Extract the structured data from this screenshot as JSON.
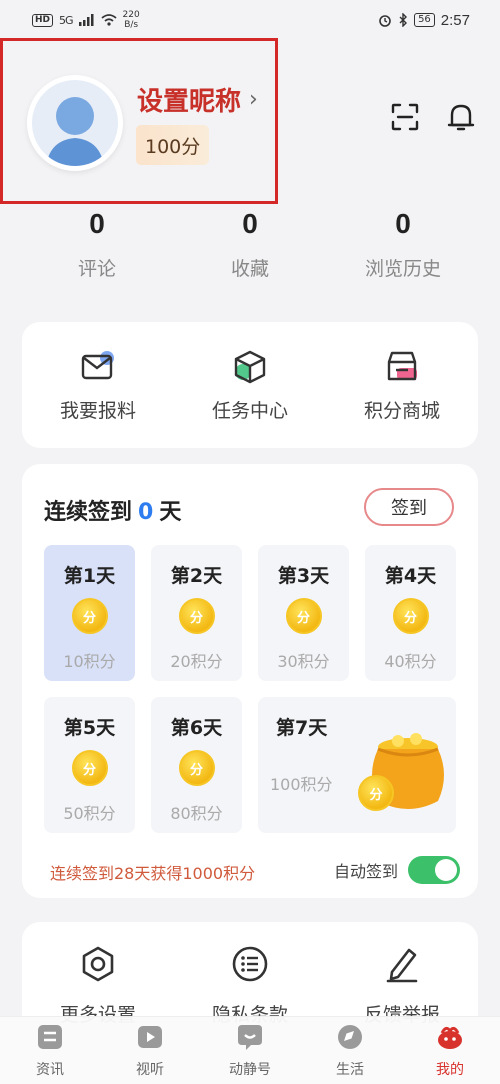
{
  "status_bar": {
    "hd": "HD",
    "network": "5G",
    "speed_value": "220",
    "speed_unit": "B/s",
    "battery": "56",
    "time": "2:57"
  },
  "profile": {
    "nickname": "设置昵称",
    "points": "100分"
  },
  "stats": [
    {
      "value": "0",
      "label": "评论"
    },
    {
      "value": "0",
      "label": "收藏"
    },
    {
      "value": "0",
      "label": "浏览历史"
    }
  ],
  "quick_actions": [
    {
      "label": "我要报料",
      "icon": "mail-icon"
    },
    {
      "label": "任务中心",
      "icon": "box-icon"
    },
    {
      "label": "积分商城",
      "icon": "shop-icon"
    }
  ],
  "signin": {
    "title_prefix": "连续签到",
    "days_count": "0",
    "title_suffix": "天",
    "button": "签到",
    "days": [
      {
        "title": "第1天",
        "points": "10积分",
        "coin": "分"
      },
      {
        "title": "第2天",
        "points": "20积分",
        "coin": "分"
      },
      {
        "title": "第3天",
        "points": "30积分",
        "coin": "分"
      },
      {
        "title": "第4天",
        "points": "40积分",
        "coin": "分"
      },
      {
        "title": "第5天",
        "points": "50积分",
        "coin": "分"
      },
      {
        "title": "第6天",
        "points": "80积分",
        "coin": "分"
      }
    ],
    "day7": {
      "title": "第7天",
      "points": "100积分",
      "coin": "分"
    },
    "bonus": "连续签到28天获得1000积分",
    "auto_label": "自动签到",
    "auto_enabled": true
  },
  "more": [
    {
      "label": "更多设置",
      "icon": "hexagon-settings-icon"
    },
    {
      "label": "隐私条款",
      "icon": "list-circle-icon"
    },
    {
      "label": "反馈举报",
      "icon": "pen-icon"
    }
  ],
  "tabs": [
    {
      "label": "资讯",
      "icon": "news-icon"
    },
    {
      "label": "视听",
      "icon": "play-icon"
    },
    {
      "label": "动静号",
      "icon": "chat-icon"
    },
    {
      "label": "生活",
      "icon": "compass-icon"
    },
    {
      "label": "我的",
      "icon": "profile-icon",
      "active": true
    }
  ],
  "colors": {
    "accent_red": "#d42727",
    "blue": "#2e7df0",
    "toggle_green": "#3cc06a"
  }
}
